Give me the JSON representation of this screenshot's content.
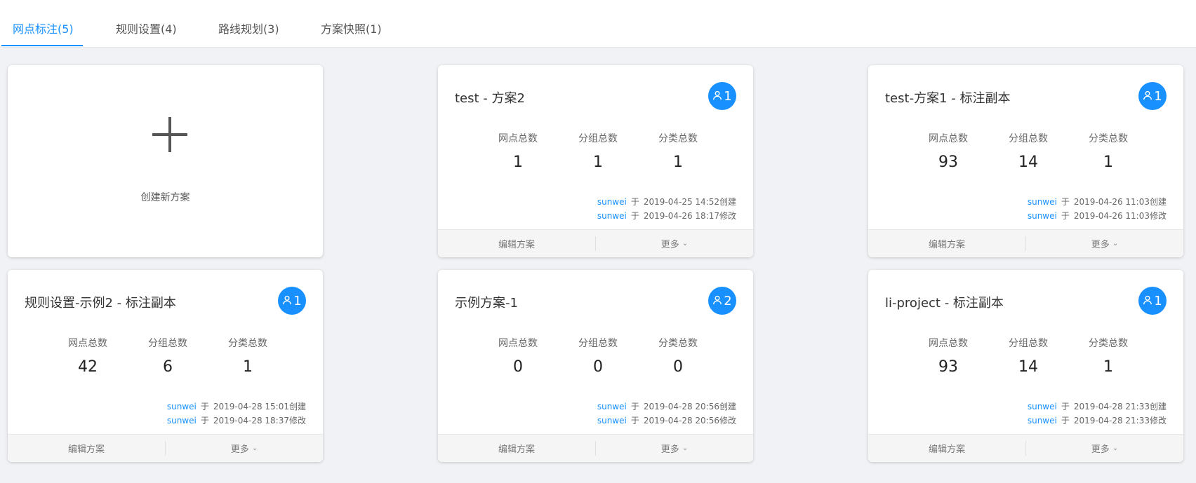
{
  "tabs": [
    {
      "label": "网点标注(5)"
    },
    {
      "label": "规则设置(4)"
    },
    {
      "label": "路线规划(3)"
    },
    {
      "label": "方案快照(1)"
    }
  ],
  "create_card": {
    "label": "创建新方案"
  },
  "stat_labels": {
    "sites": "网点总数",
    "groups": "分组总数",
    "categories": "分类总数"
  },
  "footer": {
    "edit": "编辑方案",
    "more": "更多",
    "more_icon": "chevron-down-icon"
  },
  "meta_sep": "于",
  "cards": [
    {
      "title": "test - 方案2",
      "members": "1",
      "sites": "1",
      "groups": "1",
      "categories": "1",
      "created_by": "sunwei",
      "created": "2019-04-25 14:52创建",
      "modified_by": "sunwei",
      "modified": "2019-04-26 18:17修改"
    },
    {
      "title": "test-方案1 - 标注副本",
      "members": "1",
      "sites": "93",
      "groups": "14",
      "categories": "1",
      "created_by": "sunwei",
      "created": "2019-04-26 11:03创建",
      "modified_by": "sunwei",
      "modified": "2019-04-26 11:03修改"
    },
    {
      "title": "规则设置-示例2 - 标注副本",
      "members": "1",
      "sites": "42",
      "groups": "6",
      "categories": "1",
      "created_by": "sunwei",
      "created": "2019-04-28 15:01创建",
      "modified_by": "sunwei",
      "modified": "2019-04-28 18:37修改"
    },
    {
      "title": "示例方案-1",
      "members": "2",
      "sites": "0",
      "groups": "0",
      "categories": "0",
      "created_by": "sunwei",
      "created": "2019-04-28 20:56创建",
      "modified_by": "sunwei",
      "modified": "2019-04-28 20:56修改"
    },
    {
      "title": "li-project - 标注副本",
      "members": "1",
      "sites": "93",
      "groups": "14",
      "categories": "1",
      "created_by": "sunwei",
      "created": "2019-04-28 21:33创建",
      "modified_by": "sunwei",
      "modified": "2019-04-28 21:33修改"
    }
  ],
  "colors": {
    "accent": "#1890ff",
    "background": "#f0f2f5"
  }
}
